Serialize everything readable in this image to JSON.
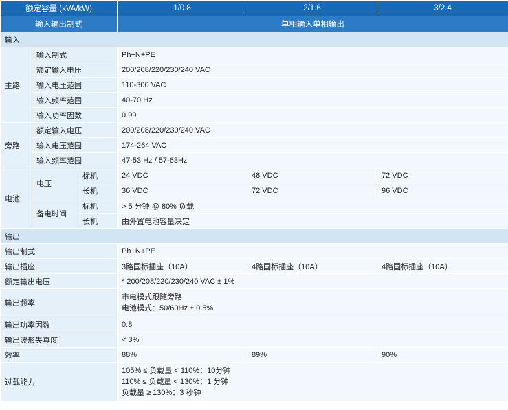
{
  "header": {
    "capacity_label": "额定容量 (kVA/kW)",
    "models": [
      "1/0.8",
      "2/1.6",
      "3/2.4"
    ],
    "io_mode_label": "输入输出制式",
    "io_mode_value": "单相输入单相输出"
  },
  "input": {
    "section_label": "输入",
    "main": {
      "label": "主路",
      "rows": [
        {
          "label": "输入制式",
          "value": "Ph+N+PE"
        },
        {
          "label": "额定输入电压",
          "value": "200/208/220/230/240 VAC"
        },
        {
          "label": "输入电压范围",
          "value": "110-300 VAC"
        },
        {
          "label": "输入频率范围",
          "value": "40-70 Hz"
        },
        {
          "label": "输入功率因数",
          "value": "0.99"
        }
      ]
    },
    "bypass": {
      "label": "旁路",
      "rows": [
        {
          "label": "额定输入电压",
          "value": "200/208/220/230/240 VAC"
        },
        {
          "label": "输入电压范围",
          "value": "174-264 VAC"
        },
        {
          "label": "输入频率范围",
          "value": "47-53 Hz / 57-63Hz"
        }
      ]
    },
    "battery": {
      "label": "电池",
      "voltage_label": "电压",
      "voltage_rows": [
        {
          "label": "标机",
          "values": [
            "24 VDC",
            "48 VDC",
            "72 VDC"
          ]
        },
        {
          "label": "长机",
          "values": [
            "36 VDC",
            "72 VDC",
            "96 VDC"
          ]
        }
      ],
      "backup_label": "备电时间",
      "backup_rows": [
        {
          "label": "标机",
          "value": "> 5 分钟 @ 80% 负载"
        },
        {
          "label": "长机",
          "value": "由外置电池容量决定"
        }
      ]
    }
  },
  "output": {
    "section_label": "输出",
    "mode": {
      "label": "输出制式",
      "value": "Ph+N+PE"
    },
    "socket": {
      "label": "输出插座",
      "values": [
        "3路国标插座（10A）",
        "4路国标插座（10A）",
        "4路国标插座（10A）"
      ]
    },
    "rated_voltage": {
      "label": "额定输出电压",
      "value": "* 200/208/220/230/240 VAC ± 1%"
    },
    "frequency": {
      "label": "输出频率",
      "lines": [
        "市电模式跟随旁路",
        "电池模式：50/60Hz ± 0.5%"
      ]
    },
    "power_factor": {
      "label": "输出功率因数",
      "value": "0.8"
    },
    "thd": {
      "label": "输出波形失真度",
      "value": "< 3%"
    },
    "efficiency": {
      "label": "效率",
      "values": [
        "88%",
        "89%",
        "90%"
      ]
    },
    "overload": {
      "label": "过载能力",
      "lines": [
        "105% ≤ 负载量 < 110%：10分钟",
        "110% ≤ 负载量 < 130%：1 分钟",
        "负载量 ≥ 130%：3 秒钟"
      ]
    }
  }
}
